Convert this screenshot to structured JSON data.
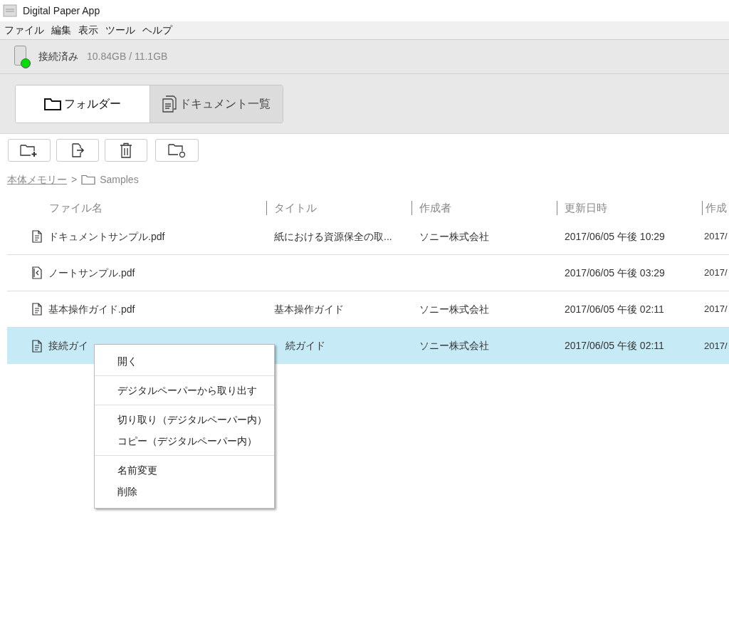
{
  "window": {
    "title": "Digital Paper App"
  },
  "menu_bar": [
    "ファイル",
    "編集",
    "表示",
    "ツール",
    "ヘルプ"
  ],
  "device": {
    "status": "接続済み",
    "storage": "10.84GB / 11.1GB",
    "connected": true
  },
  "view_tabs": [
    {
      "label": "フォルダー",
      "kind": "folder",
      "selected": true
    },
    {
      "label": "ドキュメント一覧",
      "kind": "documents",
      "selected": false
    }
  ],
  "toolbar": [
    {
      "kind": "new-folder"
    },
    {
      "kind": "export"
    },
    {
      "kind": "delete"
    },
    {
      "kind": "sync-folder"
    }
  ],
  "breadcrumb": {
    "root": "本体メモリー",
    "separator": ">",
    "folder": "Samples"
  },
  "table": {
    "columns": [
      "ファイル名",
      "タイトル",
      "作成者",
      "更新日時",
      "作成"
    ],
    "rows": [
      {
        "kind": "document",
        "selected": false,
        "cells": [
          "ドキュメントサンプル.pdf",
          "紙における資源保全の取...",
          "ソニー株式会社",
          "2017/06/05 午後 10:29",
          "2017/"
        ]
      },
      {
        "kind": "note",
        "selected": false,
        "cells": [
          "ノートサンプル.pdf",
          "",
          "",
          "2017/06/05 午後 03:29",
          "2017/"
        ]
      },
      {
        "kind": "document",
        "selected": false,
        "cells": [
          "基本操作ガイド.pdf",
          "基本操作ガイド",
          "ソニー株式会社",
          "2017/06/05 午後 02:11",
          "2017/"
        ]
      },
      {
        "kind": "document",
        "selected": true,
        "cells": [
          "接続ガイ",
          "続ガイド",
          "ソニー株式会社",
          "2017/06/05 午後 02:11",
          "2017/"
        ]
      }
    ]
  },
  "context_menu": {
    "groups": [
      [
        "開く"
      ],
      [
        "デジタルペーパーから取り出す"
      ],
      [
        "切り取り（デジタルペーパー内）",
        "コピー（デジタルペーパー内）"
      ],
      [
        "名前変更",
        "削除"
      ]
    ]
  }
}
